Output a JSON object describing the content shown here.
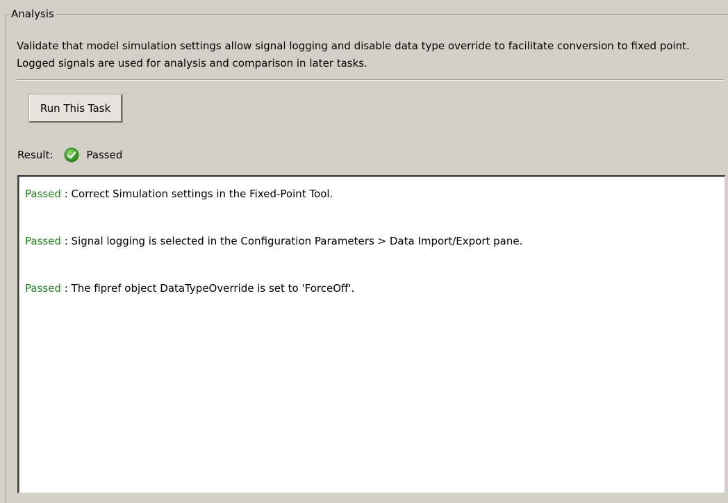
{
  "panel": {
    "title": "Analysis",
    "description": "Validate that model simulation settings allow signal logging and disable data type override to facilitate conversion to fixed point. Logged signals are used for analysis and comparison in later tasks."
  },
  "run_button": {
    "label": "Run This Task"
  },
  "result": {
    "label": "Result:",
    "status": "Passed",
    "icon": "check-circle-icon",
    "status_color": "#2e9b2e"
  },
  "results_list": [
    {
      "status": "Passed",
      "separator": " : ",
      "message": "Correct Simulation settings in the Fixed-Point Tool."
    },
    {
      "status": "Passed",
      "separator": " : ",
      "message": "Signal logging is selected in the Configuration Parameters > Data Import/Export pane."
    },
    {
      "status": "Passed",
      "separator": " : ",
      "message": "The fipref object DataTypeOverride is set to 'ForceOff'."
    }
  ]
}
